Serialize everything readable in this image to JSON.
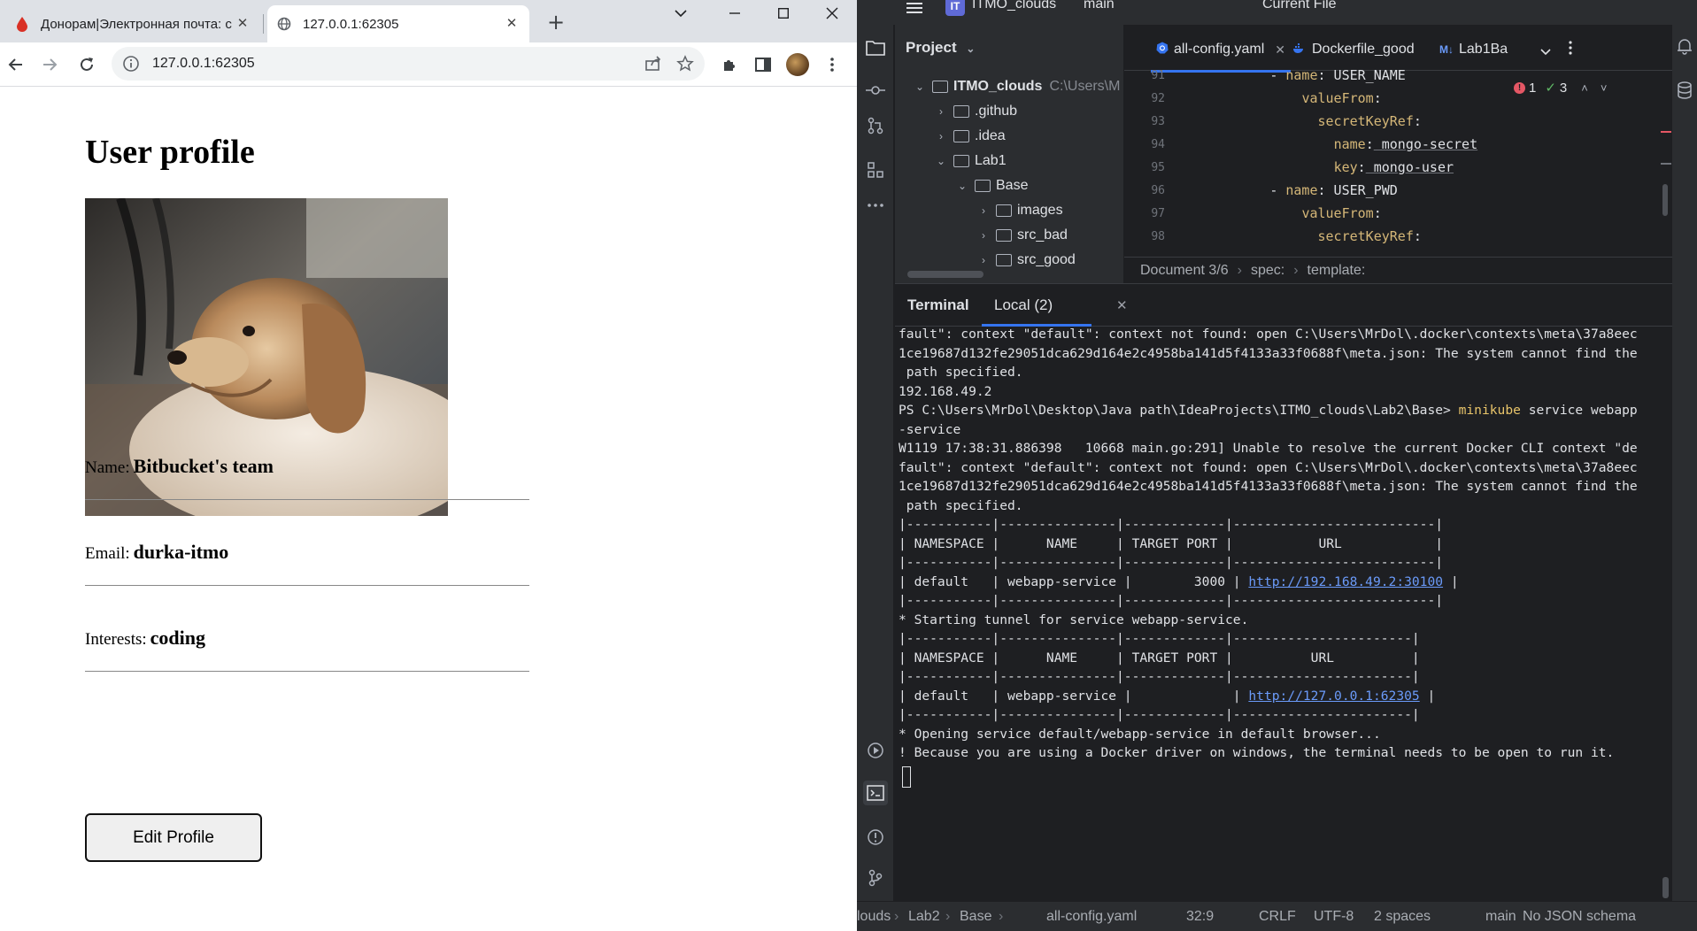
{
  "browser": {
    "tabs": [
      {
        "title": "Донорам|Электронная почта: с",
        "active": false
      },
      {
        "title": "127.0.0.1:62305",
        "active": true
      }
    ],
    "new_tab": "+",
    "url": "127.0.0.1:62305",
    "page": {
      "title": "User profile",
      "fields": [
        {
          "label": "Name:",
          "value": "Bitbucket's team"
        },
        {
          "label": "Email:",
          "value": "durka-itmo"
        },
        {
          "label": "Interests:",
          "value": "coding"
        }
      ],
      "edit_button": "Edit Profile"
    }
  },
  "ide": {
    "project_name": "ITMO_clouds",
    "branch": "main",
    "run_config": "Current File",
    "project_panel": {
      "header": "Project",
      "tree": [
        {
          "name": "ITMO_clouds",
          "extra": "C:\\Users\\M",
          "expanded": true
        },
        {
          "name": ".github",
          "expanded": false
        },
        {
          "name": ".idea",
          "expanded": false
        },
        {
          "name": "Lab1",
          "expanded": true
        },
        {
          "name": "Base",
          "expanded": true
        },
        {
          "name": "images",
          "expanded": false
        },
        {
          "name": "src_bad",
          "expanded": false
        },
        {
          "name": "src_good",
          "expanded": false
        }
      ]
    },
    "editor": {
      "tabs": [
        "all-config.yaml",
        "Dockerfile_good",
        "Lab1Ba"
      ],
      "inspections": {
        "errors": "1",
        "ok": "3"
      },
      "lines": [
        {
          "n": "91",
          "indent": 12,
          "dash": true,
          "key": "name",
          "value": "USER_NAME",
          "underline": false
        },
        {
          "n": "92",
          "indent": 14,
          "dash": false,
          "key": "valueFrom",
          "value": "",
          "underline": false
        },
        {
          "n": "93",
          "indent": 16,
          "dash": false,
          "key": "secretKeyRef",
          "value": "",
          "underline": false
        },
        {
          "n": "94",
          "indent": 18,
          "dash": false,
          "key": "name",
          "value": "mongo-secret",
          "underline": true
        },
        {
          "n": "95",
          "indent": 18,
          "dash": false,
          "key": "key",
          "value": "mongo-user",
          "underline": true
        },
        {
          "n": "96",
          "indent": 12,
          "dash": true,
          "key": "name",
          "value": "USER_PWD",
          "underline": false
        },
        {
          "n": "97",
          "indent": 14,
          "dash": false,
          "key": "valueFrom",
          "value": "",
          "underline": false
        },
        {
          "n": "98",
          "indent": 16,
          "dash": false,
          "key": "secretKeyRef",
          "value": "",
          "underline": false
        }
      ],
      "breadcrumb": [
        "Document 3/6",
        "spec:",
        "template:"
      ]
    },
    "terminal": {
      "title": "Terminal",
      "tab": "Local (2)",
      "lines": [
        {
          "segments": [
            {
              "t": "fault\": context \"default\": context not found: open C:\\Users\\MrDol\\.docker\\contexts\\meta\\37a8eec",
              "c": ""
            }
          ]
        },
        {
          "segments": [
            {
              "t": "1ce19687d132fe29051dca629d164e2c4958ba141d5f4133a33f0688f\\meta.json: The system cannot find the",
              "c": ""
            }
          ]
        },
        {
          "segments": [
            {
              "t": " path specified.",
              "c": ""
            }
          ]
        },
        {
          "segments": [
            {
              "t": "192.168.49.2",
              "c": ""
            }
          ]
        },
        {
          "segments": [
            {
              "t": "PS C:\\Users\\MrDol\\Desktop\\Java path\\IdeaProjects\\ITMO_clouds\\Lab2\\Base> ",
              "c": ""
            },
            {
              "t": "minikube",
              "c": "yl"
            },
            {
              "t": " service webapp",
              "c": ""
            }
          ]
        },
        {
          "segments": [
            {
              "t": "-service",
              "c": ""
            }
          ]
        },
        {
          "segments": [
            {
              "t": "W1119 17:38:31.886398   10668 main.go:291] Unable to resolve the current Docker CLI context \"de",
              "c": ""
            }
          ]
        },
        {
          "segments": [
            {
              "t": "fault\": context \"default\": context not found: open C:\\Users\\MrDol\\.docker\\contexts\\meta\\37a8eec",
              "c": ""
            }
          ]
        },
        {
          "segments": [
            {
              "t": "1ce19687d132fe29051dca629d164e2c4958ba141d5f4133a33f0688f\\meta.json: The system cannot find the",
              "c": ""
            }
          ]
        },
        {
          "segments": [
            {
              "t": " path specified.",
              "c": ""
            }
          ]
        },
        {
          "segments": [
            {
              "t": "|-----------|---------------|-------------|--------------------------|",
              "c": ""
            }
          ]
        },
        {
          "segments": [
            {
              "t": "| NAMESPACE |      NAME     | TARGET PORT |           URL            |",
              "c": ""
            }
          ]
        },
        {
          "segments": [
            {
              "t": "|-----------|---------------|-------------|--------------------------|",
              "c": ""
            }
          ]
        },
        {
          "segments": [
            {
              "t": "| default   | webapp-service |        3000 | ",
              "c": ""
            },
            {
              "t": "http://192.168.49.2:30100",
              "c": "lnk"
            },
            {
              "t": " |",
              "c": ""
            }
          ]
        },
        {
          "segments": [
            {
              "t": "|-----------|---------------|-------------|--------------------------|",
              "c": ""
            }
          ]
        },
        {
          "segments": [
            {
              "t": "* Starting tunnel for service webapp-service.",
              "c": ""
            }
          ]
        },
        {
          "segments": [
            {
              "t": "|-----------|---------------|-------------|-----------------------|",
              "c": ""
            }
          ]
        },
        {
          "segments": [
            {
              "t": "| NAMESPACE |      NAME     | TARGET PORT |          URL          |",
              "c": ""
            }
          ]
        },
        {
          "segments": [
            {
              "t": "|-----------|---------------|-------------|-----------------------|",
              "c": ""
            }
          ]
        },
        {
          "segments": [
            {
              "t": "| default   | webapp-service |             | ",
              "c": ""
            },
            {
              "t": "http://127.0.0.1:62305",
              "c": "lnk"
            },
            {
              "t": " |",
              "c": ""
            }
          ]
        },
        {
          "segments": [
            {
              "t": "|-----------|---------------|-------------|-----------------------|",
              "c": ""
            }
          ]
        },
        {
          "segments": [
            {
              "t": "* Opening service default/webapp-service in default browser...",
              "c": ""
            }
          ]
        },
        {
          "segments": [
            {
              "t": "! Because you are using a Docker driver on windows, the terminal needs to be open to run it.",
              "c": ""
            }
          ]
        }
      ]
    },
    "statusbar": {
      "path": [
        "louds",
        "Lab2",
        "Base",
        "all-config.yaml"
      ],
      "position": "32:9",
      "line_ending": "CRLF",
      "encoding": "UTF-8",
      "indent": "2 spaces",
      "branch": "main",
      "schema": "No JSON schema"
    }
  }
}
